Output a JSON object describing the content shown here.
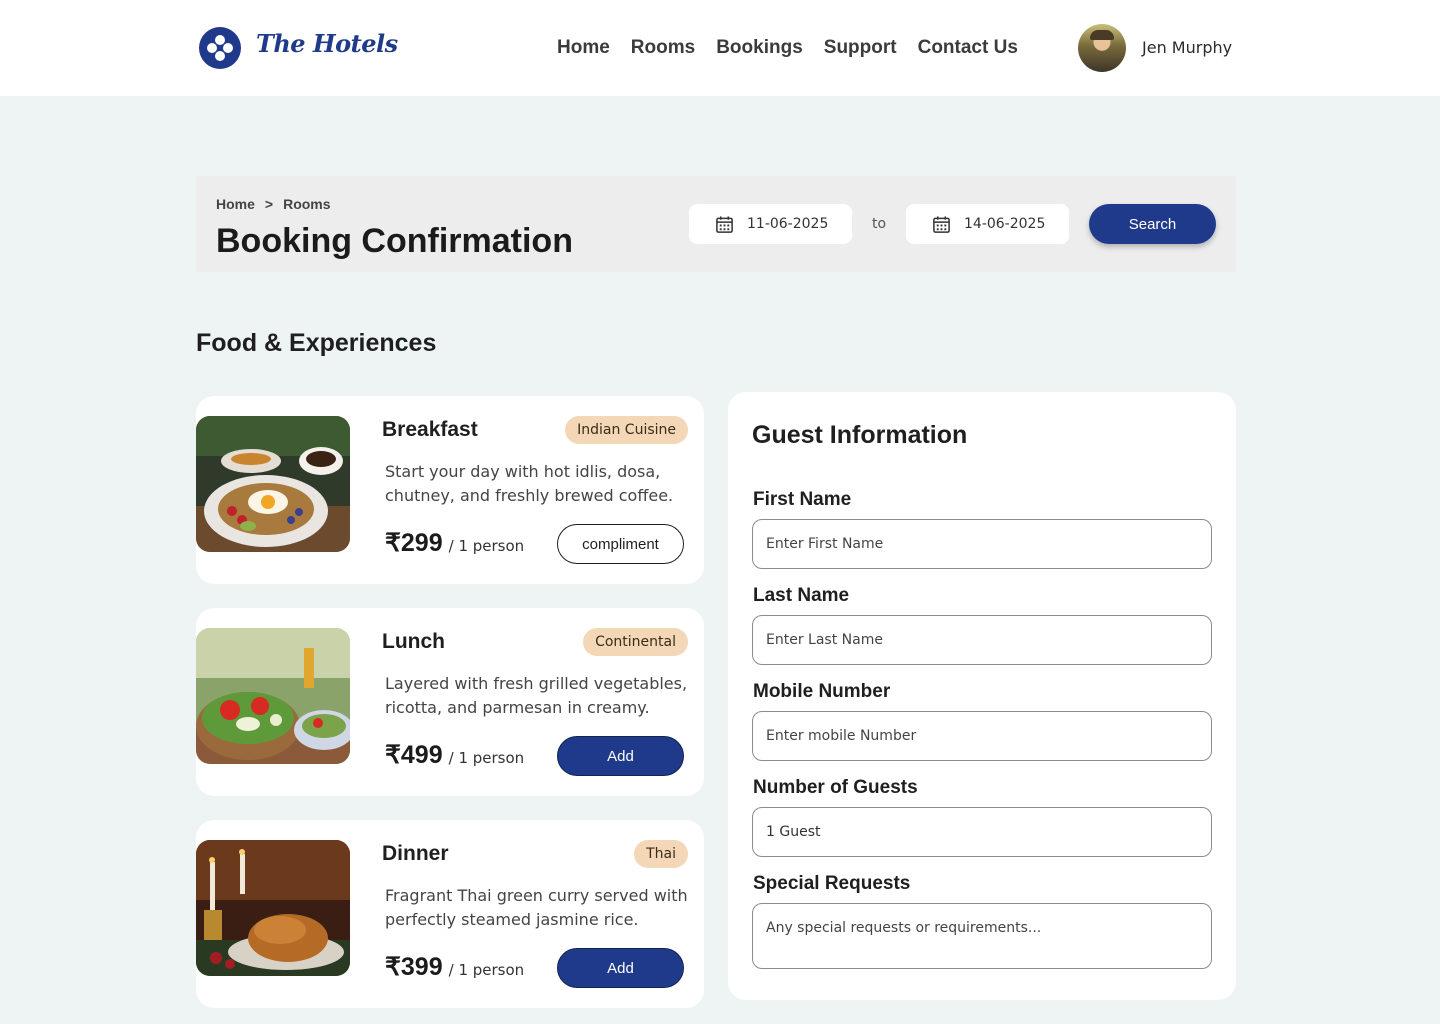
{
  "brand": {
    "name": "The Hotels",
    "accent": "#1f3a8a"
  },
  "nav": {
    "items": [
      "Home",
      "Rooms",
      "Bookings",
      "Support",
      "Contact Us"
    ]
  },
  "user": {
    "name": "Jen Murphy"
  },
  "hero": {
    "breadcrumb": [
      "Home",
      ">",
      "Rooms"
    ],
    "title": "Booking Confirmation",
    "date_from": "11-06-2025",
    "to_label": "to",
    "date_to": "14-06-2025",
    "search_label": "Search"
  },
  "section_title": "Food & Experiences",
  "food": [
    {
      "name": "Breakfast",
      "tag": "Indian Cuisine",
      "desc": "Start your day with hot idlis, dosa, chutney, and freshly brewed coffee.",
      "price": "₹299",
      "unit": "/ 1 person",
      "button": "compliment"
    },
    {
      "name": "Lunch",
      "tag": "Continental",
      "desc": "Layered with fresh grilled vegetables, ricotta, and parmesan in creamy.",
      "price": "₹499",
      "unit": "/ 1 person",
      "button": "Add"
    },
    {
      "name": "Dinner",
      "tag": "Thai",
      "desc": "Fragrant Thai green curry served with perfectly steamed jasmine rice.",
      "price": "₹399",
      "unit": "/ 1 person",
      "button": "Add"
    }
  ],
  "guest": {
    "title": "Guest Information",
    "first_name_label": "First Name",
    "first_name_placeholder": "Enter First Name",
    "last_name_label": "Last Name",
    "last_name_placeholder": "Enter Last Name",
    "mobile_label": "Mobile Number",
    "mobile_placeholder": "Enter mobile Number",
    "guests_label": "Number of Guests",
    "guests_value": "1 Guest",
    "requests_label": "Special Requests",
    "requests_placeholder": "Any special requests or requirements..."
  }
}
